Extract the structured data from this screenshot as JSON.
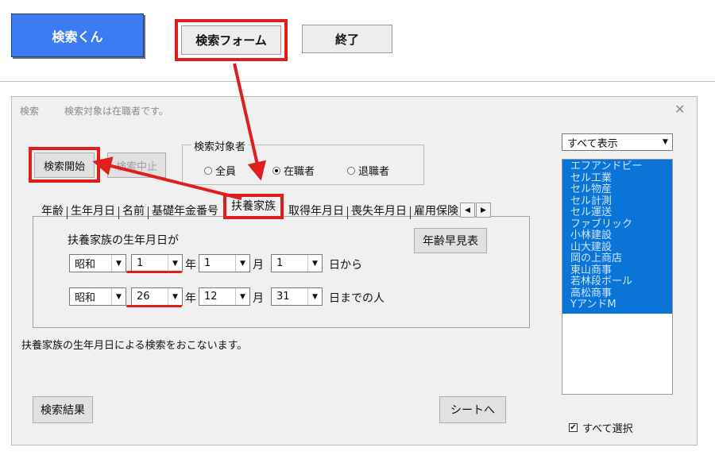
{
  "toolbar": {
    "app_button": "検索くん",
    "form_button": "検索フォーム",
    "exit_button": "終了"
  },
  "dialog": {
    "title": "検索",
    "subtitle": "検索対象は在職者です。",
    "close_glyph": "✕",
    "start_button": "検索開始",
    "stop_button": "検索中止",
    "target_group": {
      "legend": "検索対象者",
      "options": [
        {
          "label": "全員",
          "selected": false
        },
        {
          "label": "在職者",
          "selected": true
        },
        {
          "label": "退職者",
          "selected": false
        }
      ]
    },
    "tabs": [
      "年齢",
      "生年月日",
      "名前",
      "基礎年金番号",
      "扶養家族",
      "取得年月日",
      "喪失年月日",
      "雇用保険"
    ],
    "active_tab": "扶養家族",
    "tab_scroll_left": "◀",
    "tab_scroll_right": "▶",
    "panel": {
      "heading": "扶養家族の生年月日が",
      "age_table_button": "年齢早見表",
      "from_row": {
        "era": "昭和",
        "year": "1",
        "year_unit": "年",
        "month": "1",
        "month_unit": "月",
        "day": "1",
        "suffix": "日から"
      },
      "to_row": {
        "era": "昭和",
        "year": "26",
        "year_unit": "年",
        "month": "12",
        "month_unit": "月",
        "day": "31",
        "suffix": "日までの人"
      }
    },
    "description": "扶養家族の生年月日による検索をおこないます。",
    "results_button": "検索結果",
    "sheet_button": "シートへ",
    "filter_select": "すべて表示",
    "companies": [
      "エフアンドビー",
      "セル工業",
      "セル物産",
      "セル計測",
      "セル運送",
      "ファブリック",
      "小林建設",
      "山大建設",
      "岡の上商店",
      "東山商事",
      "若林段ボール",
      "高松商事",
      "YアンドM"
    ],
    "select_all_label": "すべて選択",
    "select_all_checked": true,
    "check_glyph": "✔",
    "dropdown_glyph": "▼"
  },
  "colors": {
    "accent_blue": "#3D7BF2",
    "highlight_red": "#E01E1E",
    "list_selection": "#0A75D6"
  }
}
